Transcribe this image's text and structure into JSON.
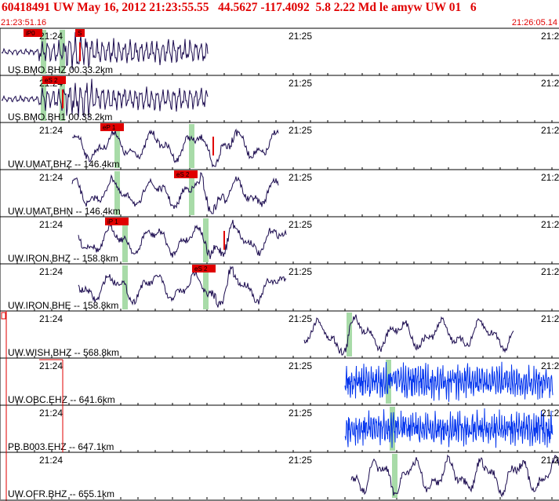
{
  "header": {
    "title": "60418491 UW May 16, 2012 21:23:55.55   44.5627 -117.4092  5.8 2.22 Md le amyw UW 01   6",
    "start_time": "21:23:51.16",
    "end_time": "21:26:05.14"
  },
  "time_labels": [
    "21:24",
    "21:25",
    "21:2"
  ],
  "colors": {
    "trace": "#1a0a4e",
    "trace_blue": "#0033ee",
    "pick_box": "#e00000",
    "pick_band": "#a8dba8",
    "header_text": "#e00000"
  },
  "traces": [
    {
      "label": "US.BMO.BHZ",
      "dist": "00.33.2km",
      "picks": [
        "iP0",
        "S"
      ],
      "color": "dark"
    },
    {
      "label": "US.BMO.BH1",
      "dist": "00.33.2km",
      "picks": [
        "eS 2"
      ],
      "color": "dark"
    },
    {
      "label": "UW.UMAT.BHZ",
      "dist": "-- 146.4km",
      "picks": [
        "eP 1"
      ],
      "color": "dark"
    },
    {
      "label": "UW.UMAT.BHN",
      "dist": "-- 146.4km",
      "picks": [
        "eS 2"
      ],
      "color": "dark"
    },
    {
      "label": "UW.IRON.BHZ",
      "dist": "-- 158.8km",
      "picks": [
        "iP 1"
      ],
      "color": "dark"
    },
    {
      "label": "UW.IRON.BHE",
      "dist": "-- 158.8km",
      "picks": [
        "eS 2"
      ],
      "color": "dark"
    },
    {
      "label": "UW.WISH.BHZ",
      "dist": "-- 568.8km",
      "picks": [],
      "color": "dark"
    },
    {
      "label": "UW.OBC.EHZ",
      "dist": "-- 641.6km",
      "picks": [],
      "color": "blue"
    },
    {
      "label": "PB.B003.EHZ",
      "dist": "-- 647.1km",
      "picks": [],
      "color": "blue"
    },
    {
      "label": "UW.OFR.BHZ",
      "dist": "-- 655.1km",
      "picks": [],
      "color": "dark"
    }
  ]
}
